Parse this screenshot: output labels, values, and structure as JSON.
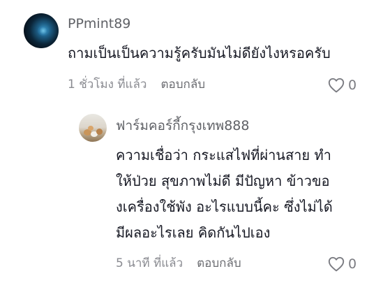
{
  "comment": {
    "username": "PPmint89",
    "text": "ถามเป็นเป็นความรู้ครับมันไม่ดียังไงหรอครับ",
    "time": "1 ชั่วโมง ที่แล้ว",
    "reply_label": "ตอบกลับ",
    "likes": "0",
    "avatar_icon": "user-avatar"
  },
  "reply": {
    "username": "ฟาร์มคอร์กี้กรุงเทพ888",
    "lines": [
      "ความเชื่อว่า กระแสไฟที่ผ่านสาย ทำ",
      "ให้ป่วย สุขภาพไม่ดี มีปัญหา ข้าวขอ",
      "งเครื่องใช้พัง อะไรแบบนี้คะ ซึ่งไม่ได้",
      "มีผลอะไรเลย คิดกันไปเอง"
    ],
    "time": "5 นาที ที่แล้ว",
    "reply_label": "ตอบกลับ",
    "likes": "0",
    "avatar_icon": "user-avatar"
  },
  "icons": {
    "like": "heart-outline-icon"
  },
  "colors": {
    "username": "#5f6166",
    "text": "#161823",
    "meta": "#8a8b91"
  }
}
